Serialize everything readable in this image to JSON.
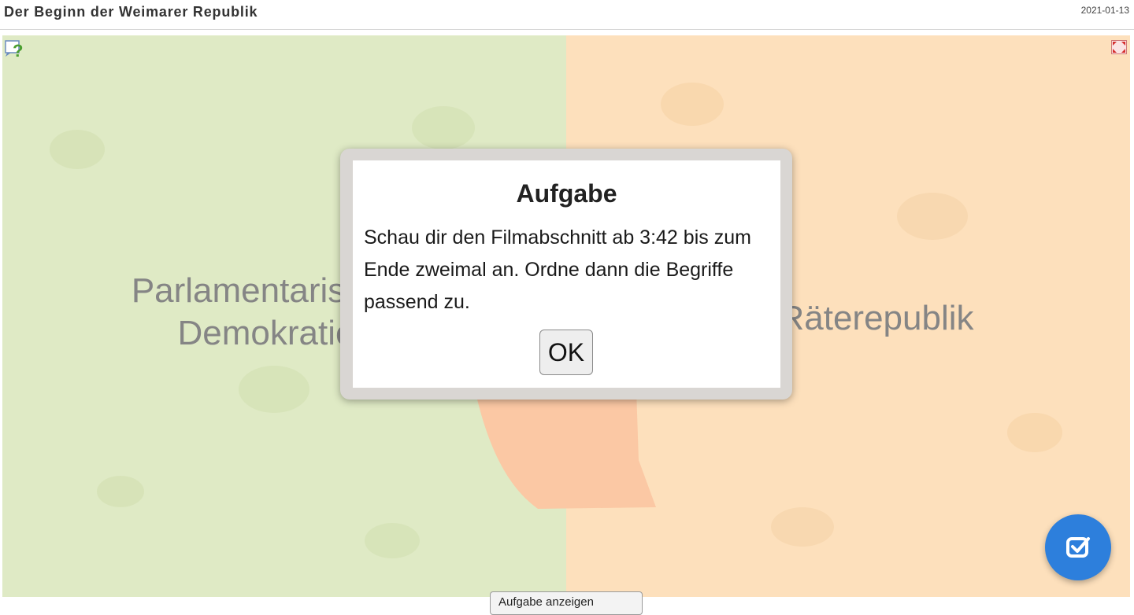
{
  "header": {
    "title": "Der Beginn der Weimarer Republik",
    "date": "2021-01-13"
  },
  "board": {
    "left_zone": {
      "label_line1": "Parlamentarische",
      "label_line2": "Demokratie",
      "color": "#dfeac5"
    },
    "right_zone": {
      "label": "Räterepublik",
      "color": "#fde0bc"
    },
    "help_icon": "help-question-icon",
    "fullscreen_icon": "fullscreen-icon",
    "check_button": {
      "icon": "checkbox-check-icon",
      "color": "#2d7fdc"
    },
    "bottom_chip_label": "Aufgabe anzeigen"
  },
  "modal": {
    "title": "Aufgabe",
    "text": "Schau dir den Filmabschnitt ab 3:42 bis zum Ende zweimal an. Ordne dann die Begriffe passend zu.",
    "ok_label": "OK"
  }
}
